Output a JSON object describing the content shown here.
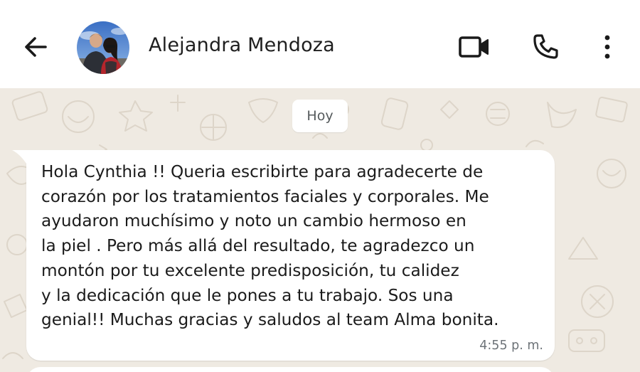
{
  "header": {
    "contact_name": "Alejandra Mendoza",
    "back_icon": "arrow-left-icon",
    "video_icon": "video-call-icon",
    "call_icon": "phone-icon",
    "menu_icon": "more-vertical-icon"
  },
  "chat": {
    "date_divider": "Hoy",
    "messages": [
      {
        "text": "Hola Cynthia !! Queria escribirte para agradecerte de\ncorazón por los tratamientos faciales y corporales. Me\nayudaron muchísimo y noto un cambio hermoso en\nla piel . Pero más  allá del resultado, te agradezco un\nmontón por tu excelente predisposición, tu calidez\ny la dedicación que le pones a tu trabajo. Sos una\ngenial!! Muchas gracias y saludos al team Alma bonita.",
        "time": "4:55 p. m."
      }
    ]
  },
  "colors": {
    "header_bg": "#ffffff",
    "chat_bg": "#efeae2",
    "bubble_bg": "#ffffff",
    "icon_color": "#1a1a1a",
    "time_color": "#6d7378"
  }
}
